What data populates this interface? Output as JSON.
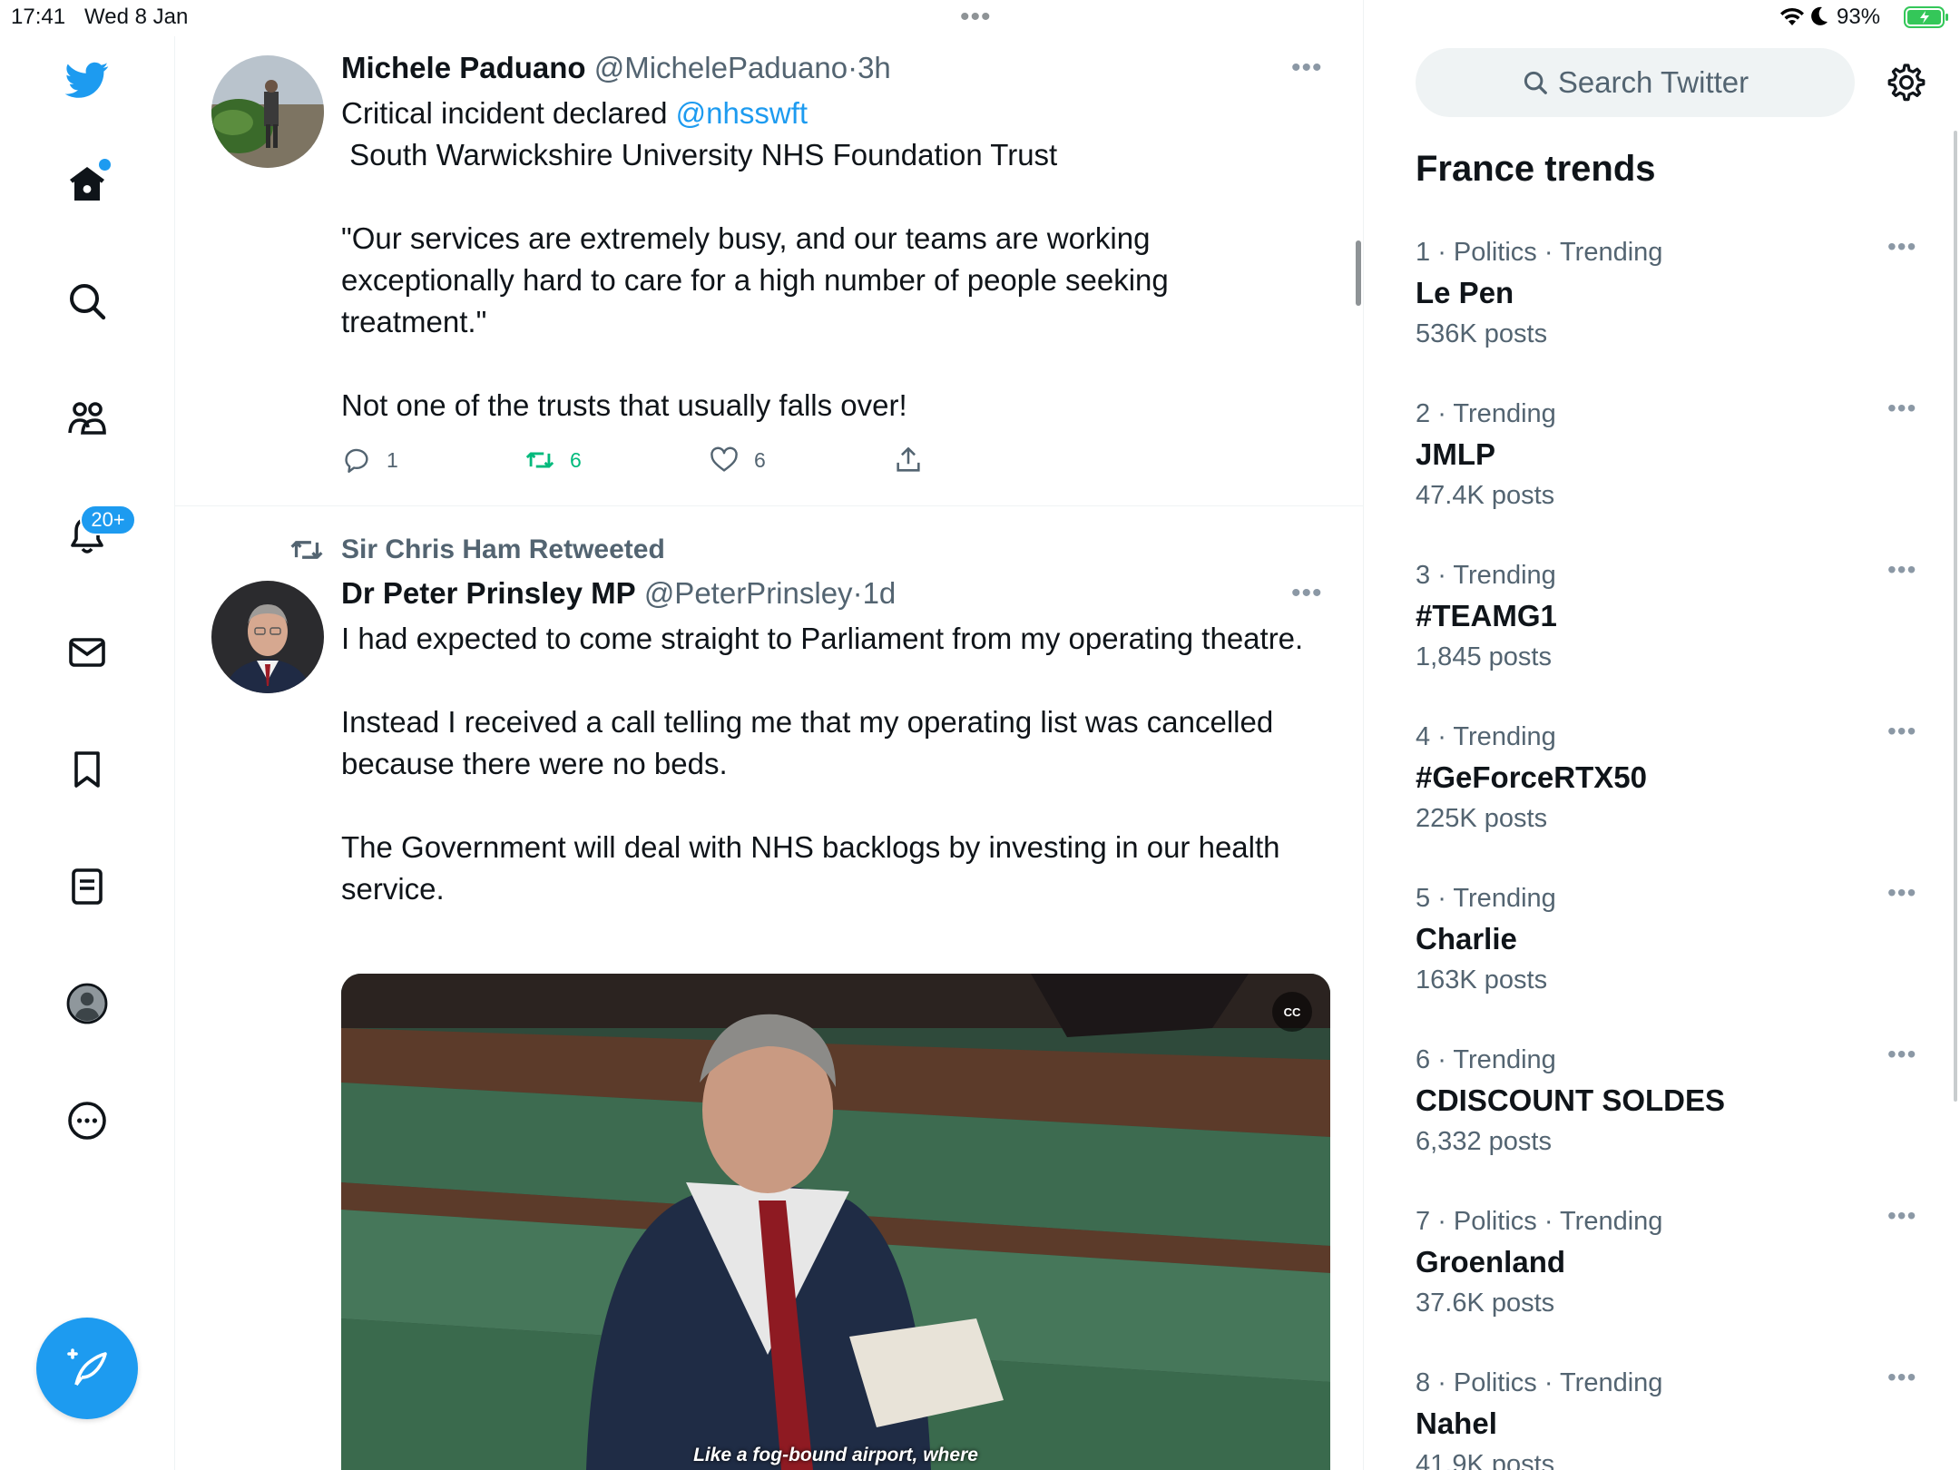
{
  "status_bar": {
    "time": "17:41",
    "date": "Wed 8 Jan",
    "battery_pct": "93%",
    "center_dots": "•••"
  },
  "nav": {
    "notifications_badge": "20+",
    "icons": [
      "twitter-logo-icon",
      "home-icon",
      "search-icon",
      "communities-icon",
      "bell-icon",
      "mail-icon",
      "bookmark-icon",
      "lists-icon",
      "profile-icon",
      "more-icon",
      "compose-icon"
    ]
  },
  "tweets": [
    {
      "name": "Michele Paduano",
      "handle": "@MichelePaduano",
      "sep": "·",
      "time": "3h",
      "more": "•••",
      "line1_prefix": "Critical incident declared ",
      "line1_mention": "@nhsswft",
      "line2": " South Warwickshire University NHS Foundation Trust",
      "quote": "\"Our services are extremely busy, and our teams are working exceptionally hard to care for a high number of people seeking treatment.\"",
      "line_last": "Not one of the trusts that usually falls over!",
      "replies": "1",
      "retweets": "6",
      "likes": "6"
    },
    {
      "retweeted_by": "Sir Chris Ham Retweeted",
      "name": "Dr Peter Prinsley MP",
      "handle": "@PeterPrinsley",
      "sep": "·",
      "time": "1d",
      "more": "•••",
      "para1": "I had expected to come straight to Parliament from my operating theatre.",
      "para2": "Instead I received a call telling me that my operating list was cancelled because there were no beds.",
      "para3": "The Government will deal with NHS backlogs by investing in our health service.",
      "media_cc": "CC",
      "media_subtitle": "Like a fog-bound airport, where"
    }
  ],
  "sidebar": {
    "search_placeholder": "Search Twitter",
    "trends_title": "France trends",
    "more": "•••",
    "trends": [
      {
        "rank": "1",
        "category": "Politics · Trending",
        "name": "Le Pen",
        "posts": "536K posts"
      },
      {
        "rank": "2",
        "category": "Trending",
        "name": "JMLP",
        "posts": "47.4K posts"
      },
      {
        "rank": "3",
        "category": "Trending",
        "name": "#TEAMG1",
        "posts": "1,845 posts"
      },
      {
        "rank": "4",
        "category": "Trending",
        "name": "#GeForceRTX50",
        "posts": "225K posts"
      },
      {
        "rank": "5",
        "category": "Trending",
        "name": "Charlie",
        "posts": "163K posts"
      },
      {
        "rank": "6",
        "category": "Trending",
        "name": "CDISCOUNT SOLDES",
        "posts": "6,332 posts"
      },
      {
        "rank": "7",
        "category": "Politics · Trending",
        "name": "Groenland",
        "posts": "37.6K posts"
      },
      {
        "rank": "8",
        "category": "Politics · Trending",
        "name": "Nahel",
        "posts": "41.9K posts"
      }
    ]
  },
  "colors": {
    "accent": "#1d9bf0",
    "retweet_green": "#00ba7c",
    "text_primary": "#0f1419",
    "text_secondary": "#536471",
    "battery_green": "#34c759"
  }
}
